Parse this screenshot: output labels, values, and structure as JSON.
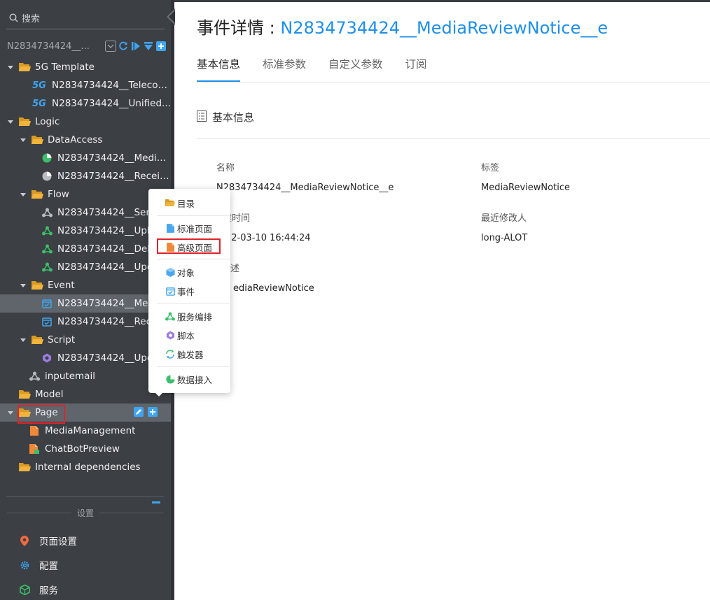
{
  "sidebar": {
    "search_placeholder": "搜索",
    "app_name": "N2834734424__...",
    "tree": [
      {
        "label": "5G Template",
        "type": "folder"
      },
      {
        "label": "N2834734424__Telecom...",
        "type": "5g"
      },
      {
        "label": "N2834734424__Unified...",
        "type": "5g"
      },
      {
        "label": "Logic",
        "type": "folder"
      },
      {
        "label": "DataAccess",
        "type": "folder"
      },
      {
        "label": "N2834734424__Media...",
        "type": "data-green"
      },
      {
        "label": "N2834734424__Receiv...",
        "type": "data-grey"
      },
      {
        "label": "Flow",
        "type": "folder"
      },
      {
        "label": "N2834734424__Sen",
        "type": "flow-grey"
      },
      {
        "label": "N2834734424__Uplo",
        "type": "flow-green"
      },
      {
        "label": "N2834734424__Dele",
        "type": "flow-green"
      },
      {
        "label": "N2834734424__Upd",
        "type": "flow-green"
      },
      {
        "label": "Event",
        "type": "folder"
      },
      {
        "label": "N2834734424__Med",
        "type": "event"
      },
      {
        "label": "N2834734424__Rece",
        "type": "event"
      },
      {
        "label": "Script",
        "type": "folder"
      },
      {
        "label": "N2834734424__Upd",
        "type": "script"
      },
      {
        "label": "inputemail",
        "type": "flow-grey"
      },
      {
        "label": "Model",
        "type": "folder"
      },
      {
        "label": "Page",
        "type": "folder"
      },
      {
        "label": "MediaManagement",
        "type": "page"
      },
      {
        "label": "ChatBotPreview",
        "type": "page2"
      },
      {
        "label": "Internal dependencies",
        "type": "folder"
      }
    ],
    "settings_title": "设置",
    "bottom_items": [
      {
        "label": "页面设置",
        "icon": "location-pin-icon"
      },
      {
        "label": "配置",
        "icon": "gear-icon"
      },
      {
        "label": "服务",
        "icon": "cube-icon"
      }
    ]
  },
  "context_menu": {
    "items": [
      {
        "label": "目录",
        "icon": "folder-icon"
      },
      {
        "label": "标准页面",
        "icon": "standard-page-icon"
      },
      {
        "label": "高级页面",
        "icon": "advanced-page-icon"
      },
      {
        "label": "对象",
        "icon": "object-cube-icon"
      },
      {
        "label": "事件",
        "icon": "event-calendar-icon"
      },
      {
        "label": "服务编排",
        "icon": "flow-icon"
      },
      {
        "label": "脚本",
        "icon": "script-icon"
      },
      {
        "label": "触发器",
        "icon": "trigger-icon"
      },
      {
        "label": "数据接入",
        "icon": "data-access-icon"
      }
    ]
  },
  "main": {
    "title_prefix": "事件详情 : ",
    "title_name": "N2834734424__MediaReviewNotice__e",
    "tabs": [
      "基本信息",
      "标准参数",
      "自定义参数",
      "订阅"
    ],
    "section_title": "基本信息",
    "fields": {
      "name_label": "名称",
      "name_value": "N2834734424__MediaReviewNotice__e",
      "tag_label": "标签",
      "tag_value": "MediaReviewNotice",
      "created_label": "建时间",
      "created_value": "22-03-10 16:44:24",
      "modifier_label": "最近修改人",
      "modifier_value": "long-ALOT",
      "desc_label": "述",
      "desc_value": "ediaReviewNotice"
    }
  },
  "colors": {
    "accent": "#1f8fe8",
    "sidebar_bg": "#3c3f44",
    "highlight_red": "#e0222a",
    "folder_yellow": "#f2b33d"
  }
}
